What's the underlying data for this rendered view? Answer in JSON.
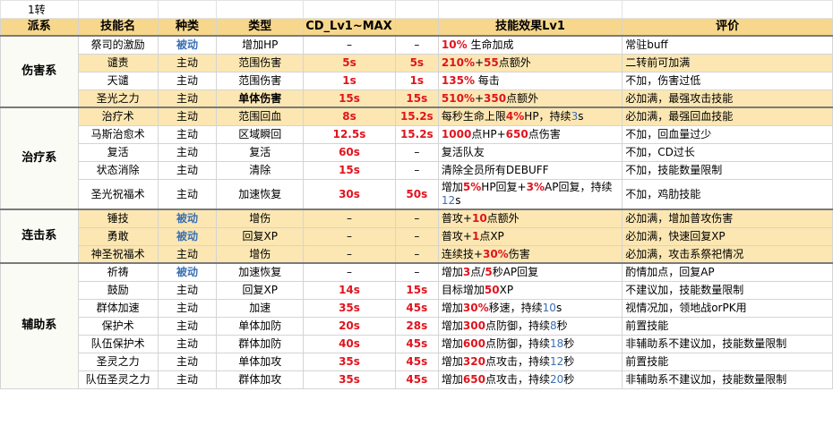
{
  "sheet_label": "1转",
  "headers": [
    "派系",
    "技能名",
    "种类",
    "类型",
    "CD_Lv1~MAX",
    "",
    "技能效果Lv1",
    "评价"
  ],
  "groups": [
    {
      "name": "伤害系",
      "rows": [
        {
          "name": "祭司的激励",
          "kind": "被动",
          "type": "增加HP",
          "cd1": "–",
          "cd2": "–",
          "effect": "10% 生命加成",
          "comment": "常驻buff",
          "hl": false
        },
        {
          "name": "谴责",
          "kind": "主动",
          "type": "范围伤害",
          "cd1": "5s",
          "cd2": "5s",
          "effect": "210%+55点额外",
          "comment": "二转前可加满",
          "hl": true
        },
        {
          "name": "天谴",
          "kind": "主动",
          "type": "范围伤害",
          "cd1": "1s",
          "cd2": "1s",
          "effect": "135% 每击",
          "comment": "不加，伤害过低",
          "hl": false
        },
        {
          "name": "圣光之力",
          "kind": "主动",
          "type": "单体伤害",
          "cd1": "15s",
          "cd2": "15s",
          "effect": "510%+350点额外",
          "comment": "必加满，最强攻击技能",
          "hl": true
        }
      ]
    },
    {
      "name": "治疗系",
      "rows": [
        {
          "name": "治疗术",
          "kind": "主动",
          "type": "范围回血",
          "cd1": "8s",
          "cd2": "15.2s",
          "effect": "每秒生命上限4%HP，持续3s",
          "comment": "必加满，最强回血技能",
          "hl": true
        },
        {
          "name": "马斯治愈术",
          "kind": "主动",
          "type": "区域瞬回",
          "cd1": "12.5s",
          "cd2": "15.2s",
          "effect": "1000点HP+650点伤害",
          "comment": "不加，回血量过少",
          "hl": false
        },
        {
          "name": "复活",
          "kind": "主动",
          "type": "复活",
          "cd1": "60s",
          "cd2": "–",
          "effect": "复活队友",
          "comment": "不加，CD过长",
          "hl": false
        },
        {
          "name": "状态消除",
          "kind": "主动",
          "type": "清除",
          "cd1": "15s",
          "cd2": "–",
          "effect": "清除全员所有DEBUFF",
          "comment": "不加，技能数量限制",
          "hl": false
        },
        {
          "name": "圣光祝福术",
          "kind": "主动",
          "type": "加速恢复",
          "cd1": "30s",
          "cd2": "50s",
          "effect": "增加5%HP回复+3%AP回复，持续12s",
          "comment": "不加，鸡肋技能",
          "hl": false
        }
      ]
    },
    {
      "name": "连击系",
      "rows": [
        {
          "name": "锤技",
          "kind": "被动",
          "type": "增伤",
          "cd1": "–",
          "cd2": "–",
          "effect": "普攻+10点额外",
          "comment": "必加满，增加普攻伤害",
          "hl": true
        },
        {
          "name": "勇敢",
          "kind": "被动",
          "type": "回复XP",
          "cd1": "–",
          "cd2": "–",
          "effect": "普攻+1点XP",
          "comment": "必加满，快速回复XP",
          "hl": true
        },
        {
          "name": "神圣祝福术",
          "kind": "主动",
          "type": "增伤",
          "cd1": "–",
          "cd2": "–",
          "effect": "连续技+30%伤害",
          "comment": "必加满，攻击系祭祀情况",
          "hl": true
        }
      ]
    },
    {
      "name": "辅助系",
      "rows": [
        {
          "name": "祈祷",
          "kind": "被动",
          "type": "加速恢复",
          "cd1": "–",
          "cd2": "–",
          "effect": "增加3点/5秒AP回复",
          "comment": "酌情加点，回复AP",
          "hl": false
        },
        {
          "name": "鼓励",
          "kind": "主动",
          "type": "回复XP",
          "cd1": "14s",
          "cd2": "15s",
          "effect": "目标增加50XP",
          "comment": "不建议加，技能数量限制",
          "hl": false
        },
        {
          "name": "群体加速",
          "kind": "主动",
          "type": "加速",
          "cd1": "35s",
          "cd2": "45s",
          "effect": "增加30%移速，持续10s",
          "comment": "视情况加，领地战orPK用",
          "hl": false
        },
        {
          "name": "保护术",
          "kind": "主动",
          "type": "单体加防",
          "cd1": "20s",
          "cd2": "28s",
          "effect": "增加300点防御，持续8秒",
          "comment": "前置技能",
          "hl": false
        },
        {
          "name": "队伍保护术",
          "kind": "主动",
          "type": "群体加防",
          "cd1": "40s",
          "cd2": "45s",
          "effect": "增加600点防御，持续18秒",
          "comment": "非辅助系不建议加，技能数量限制",
          "hl": false
        },
        {
          "name": "圣灵之力",
          "kind": "主动",
          "type": "单体加攻",
          "cd1": "35s",
          "cd2": "45s",
          "effect": "增加320点攻击，持续12秒",
          "comment": "前置技能",
          "hl": false
        },
        {
          "name": "队伍圣灵之力",
          "kind": "主动",
          "type": "群体加攻",
          "cd1": "35s",
          "cd2": "45s",
          "effect": "增加650点攻击，持续20秒",
          "comment": "非辅助系不建议加，技能数量限制",
          "hl": false
        }
      ]
    }
  ]
}
